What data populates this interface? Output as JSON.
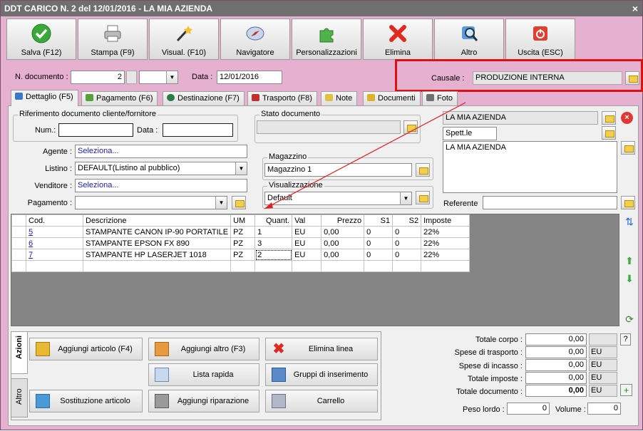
{
  "window": {
    "title": "DDT CARICO N. 2 del 12/01/2016 - LA MIA AZIENDA",
    "close": "×"
  },
  "toolbar": [
    {
      "label": "Salva (F12)",
      "icon": "check-icon"
    },
    {
      "label": "Stampa (F9)",
      "icon": "printer-icon"
    },
    {
      "label": "Visual. (F10)",
      "icon": "wand-icon"
    },
    {
      "label": "Navigatore",
      "icon": "compass-icon"
    },
    {
      "label": "Personalizzazioni",
      "icon": "puzzle-icon"
    },
    {
      "label": "Elimina",
      "icon": "red-x-icon"
    },
    {
      "label": "Altro",
      "icon": "magnifier-icon"
    },
    {
      "label": "Uscita (ESC)",
      "icon": "power-icon"
    }
  ],
  "header": {
    "num_label": "N. documento :",
    "num_value": "2",
    "date_label": "Data :",
    "date_value": "12/01/2016",
    "causale_label": "Causale :",
    "causale_value": "PRODUZIONE INTERNA"
  },
  "tabs": [
    {
      "label": "Dettaglio (F5)",
      "color": "#3a78c8"
    },
    {
      "label": "Pagamento (F6)",
      "color": "#58a03a"
    },
    {
      "label": "Destinazione (F7)",
      "color": "#2a7a4a"
    },
    {
      "label": "Trasporto (F8)",
      "color": "#c03030"
    },
    {
      "label": "Note",
      "color": "#e0c040"
    },
    {
      "label": "Documenti",
      "color": "#e0b030"
    },
    {
      "label": "Foto",
      "color": "#707070"
    }
  ],
  "rif": {
    "group": "Riferimento documento cliente/fornitore",
    "num_label": "Num.:",
    "num_value": "",
    "data_label": "Data :",
    "data_value": ""
  },
  "stato": {
    "group": "Stato documento",
    "value": ""
  },
  "anagrafica": {
    "name": "LA MIA AZIENDA",
    "title": "Spett.le",
    "address": "LA MIA AZIENDA",
    "referente_label": "Referente",
    "referente_value": ""
  },
  "fields": {
    "agente_label": "Agente :",
    "agente_value": "Seleziona...",
    "listino_label": "Listino :",
    "listino_value": "DEFAULT(Listino al pubblico)",
    "venditore_label": "Venditore :",
    "venditore_value": "Seleziona...",
    "pagamento_label": "Pagamento :",
    "pagamento_value": "",
    "magazzino_group": "Magazzino",
    "magazzino_value": "Magazzino 1",
    "visual_group": "Visualizzazione",
    "visual_value": "Default"
  },
  "grid": {
    "columns": [
      "Cod.",
      "Descrizione",
      "UM",
      "Quant.",
      "Val",
      "Prezzo",
      "S1",
      "S2",
      "Imposte"
    ],
    "rows": [
      {
        "cod": "5",
        "desc": "STAMPANTE CANON IP-90 PORTATILE",
        "um": "PZ",
        "qty": "1",
        "val": "EU",
        "price": "0,00",
        "s1": "0",
        "s2": "0",
        "tax": "22%"
      },
      {
        "cod": "6",
        "desc": "STAMPANTE EPSON FX 890",
        "um": "PZ",
        "qty": "3",
        "val": "EU",
        "price": "0,00",
        "s1": "0",
        "s2": "0",
        "tax": "22%"
      },
      {
        "cod": "7",
        "desc": "STAMPANTE HP LASERJET 1018",
        "um": "PZ",
        "qty": "2",
        "val": "EU",
        "price": "0,00",
        "s1": "0",
        "s2": "0",
        "tax": "22%"
      }
    ]
  },
  "side_tabs": {
    "azioni": "Azioni",
    "altro": "Altro"
  },
  "actions": {
    "add_article": "Aggiungi articolo (F4)",
    "add_other": "Aggiungi altro (F3)",
    "delete_line": "Elimina linea",
    "quick_list": "Lista rapida",
    "groups": "Gruppi di inserimento",
    "substitute": "Sostituzione articolo",
    "add_repair": "Aggiungi riparazione",
    "cart": "Carrello"
  },
  "totals": {
    "corpo_label": "Totale corpo :",
    "corpo": "0,00",
    "help": "?",
    "trasporto_label": "Spese di trasporto :",
    "trasporto": "0,00",
    "incasso_label": "Spese di incasso :",
    "incasso": "0,00",
    "imposte_label": "Totale imposte :",
    "imposte": "0,00",
    "documento_label": "Totale documento :",
    "documento": "0,00",
    "currency": "EU",
    "peso_label": "Peso lordo :",
    "peso": "0",
    "volume_label": "Volume :",
    "volume": "0"
  }
}
